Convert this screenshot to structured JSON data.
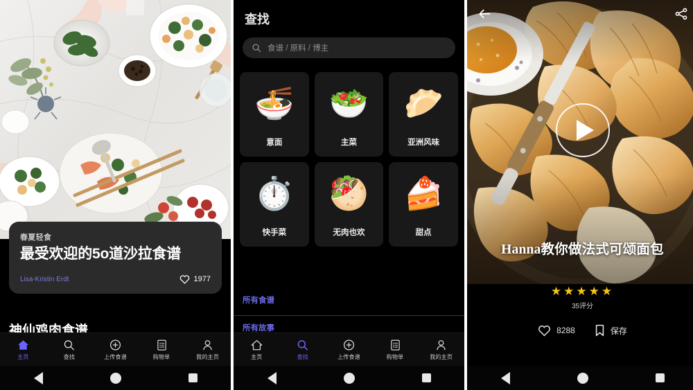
{
  "left_panel": {
    "hero": {
      "alt_name": "salad-flatlay-photo"
    },
    "card": {
      "eyebrow": "春夏轻食",
      "title": "最受欢迎的5o道沙拉食谱",
      "author": "Lisa-Kristin Erdt",
      "likes": "1977",
      "heart_icon": "heart-icon"
    },
    "next_title": "神仙鸡肉食谱"
  },
  "middle_panel": {
    "header_title": "查找",
    "search": {
      "placeholder": "食谱 / 原料 / 博主",
      "icon": "search-icon",
      "value": ""
    },
    "categories": [
      {
        "label": "意面",
        "emoji": "🍜",
        "icon_name": "pasta-bowl-icon"
      },
      {
        "label": "主菜",
        "emoji": "🥗",
        "icon_name": "main-dish-bowl-icon"
      },
      {
        "label": "亚洲风味",
        "emoji": "🥟",
        "icon_name": "dim-sum-steamer-icon"
      },
      {
        "label": "快手菜",
        "emoji": "⏱️",
        "icon_name": "stopwatch-icon"
      },
      {
        "label": "无肉也欢",
        "emoji": "🥙",
        "icon_name": "salad-bowl-icon"
      },
      {
        "label": "甜点",
        "emoji": "🍰",
        "icon_name": "cake-slice-icon"
      }
    ],
    "links": [
      {
        "label": "所有食谱"
      },
      {
        "label": "所有故事"
      }
    ]
  },
  "right_panel": {
    "back_icon": "back-arrow-icon",
    "share_icon": "share-icon",
    "play_icon": "play-icon",
    "video_title": "Hanna教你做法式可颂面包",
    "rating": {
      "stars": "★★★★★",
      "star_count": 5,
      "count_label": "35评分"
    },
    "actions": [
      {
        "label": "8288",
        "icon_name": "heart-icon"
      },
      {
        "label": "保存",
        "icon_name": "bookmark-icon"
      }
    ]
  },
  "tabbar": {
    "items": [
      {
        "label": "主页",
        "icon_name": "home-icon"
      },
      {
        "label": "查找",
        "icon_name": "search-icon"
      },
      {
        "label": "上传食谱",
        "icon_name": "plus-circle-icon"
      },
      {
        "label": "购物单",
        "icon_name": "clipboard-list-icon"
      },
      {
        "label": "我的主页",
        "icon_name": "person-icon"
      }
    ]
  },
  "android_nav": {
    "back": "back-triangle-icon",
    "home": "home-circle-icon",
    "recents": "recents-square-icon"
  },
  "colors": {
    "accent": "#6c63ff",
    "link": "#6a6ae8",
    "star": "#f5c518",
    "panel_bg": "#000000",
    "card_bg": "#2b2b2b"
  }
}
